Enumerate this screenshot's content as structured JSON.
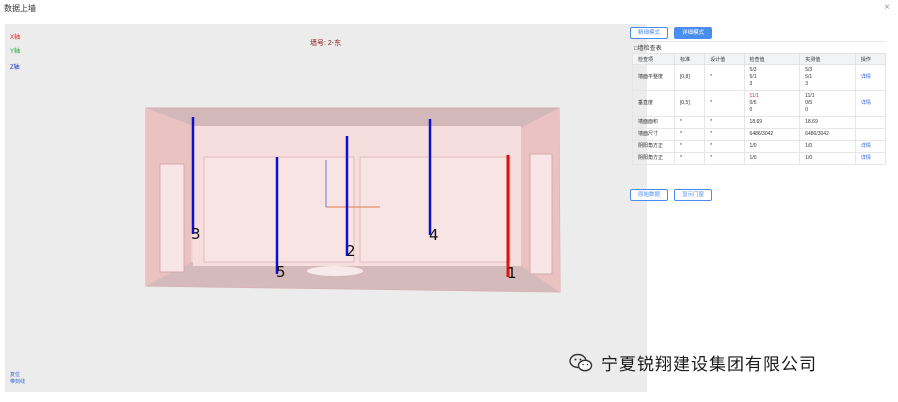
{
  "window": {
    "title": "数据上墙",
    "close_glyph": "×"
  },
  "viewport": {
    "axis_legend": {
      "x": "X轴",
      "y": "Y轴",
      "z": "Z轴"
    },
    "wall_label": "墙号: 2-东",
    "markers": [
      "3",
      "2",
      "4",
      "5",
      "1"
    ],
    "bottom_links": [
      "复位",
      "带刻线"
    ]
  },
  "panel": {
    "mode_buttons": [
      "精细模式",
      "详细模式"
    ],
    "active_mode": "详细模式",
    "section_title": "□墙检查表",
    "columns": [
      "检查项",
      "标准",
      "设计值",
      "检查值",
      "实测值",
      "操作"
    ],
    "rows": [
      {
        "name": "墙面平整度",
        "standard": "[0,8]",
        "design": "*",
        "check": [
          "5/3",
          "5/1",
          "3"
        ],
        "measured": [
          "5/3",
          "5/1",
          "3"
        ],
        "action": "详情"
      },
      {
        "name": "垂直度",
        "standard": "[0,5]",
        "design": "*",
        "check": [
          "11/1",
          "0/5",
          "0"
        ],
        "measured": [
          "11/1",
          "0/5",
          "0"
        ],
        "action": "详情"
      },
      {
        "name": "墙面面积",
        "standard": "*",
        "design": "*",
        "check": [
          "18.69"
        ],
        "measured": [
          "18.69"
        ],
        "action": ""
      },
      {
        "name": "墙面尺寸",
        "standard": "*",
        "design": "*",
        "check": [
          "6486/3042"
        ],
        "measured": [
          "6486/3042"
        ],
        "action": ""
      },
      {
        "name": "阴阳角方正",
        "standard": "*",
        "design": "*",
        "check": [
          "1/0"
        ],
        "measured": [
          "1/0"
        ],
        "action": "详情"
      },
      {
        "name": "阴阳角方正",
        "standard": "*",
        "design": "*",
        "check": [
          "1/0"
        ],
        "measured": [
          "1/0"
        ],
        "action": "详情"
      }
    ],
    "bottom_buttons": [
      "原始数据",
      "显示门窗"
    ]
  },
  "watermark": {
    "text": "宁夏锐翔建设集团有限公司",
    "icon": "wechat-icon"
  },
  "colors": {
    "accent": "#4a8df0",
    "warning": "#e02020",
    "marker_blue": "#1010cc",
    "marker_red": "#e01010",
    "wall": "#f2cccc"
  }
}
